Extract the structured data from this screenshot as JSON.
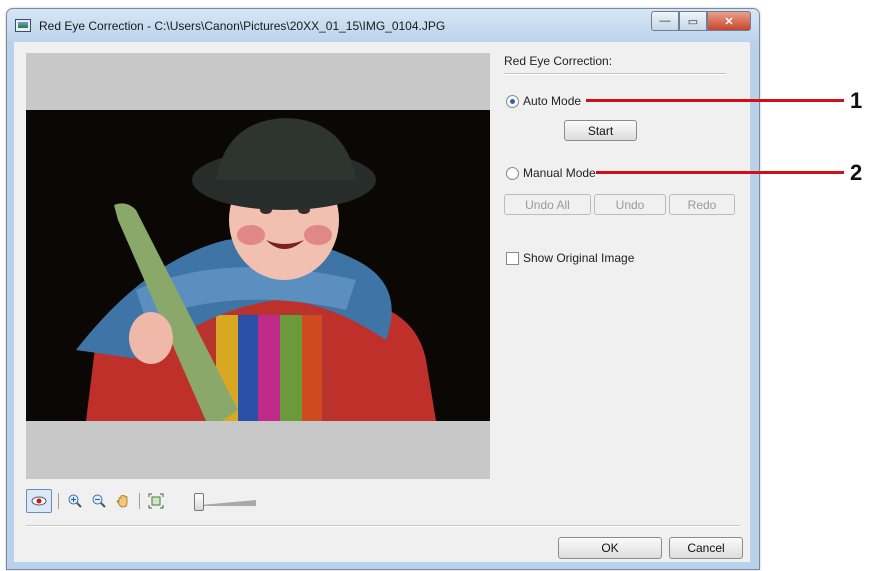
{
  "window": {
    "title": "Red Eye Correction - C:\\Users\\Canon\\Pictures\\20XX_01_15\\IMG_0104.JPG",
    "caption_buttons": {
      "minimize": "—",
      "maximize": "▭",
      "close": "✕"
    }
  },
  "panel": {
    "title": "Red Eye Correction:",
    "auto_mode": {
      "label": "Auto Mode",
      "selected": true
    },
    "start_label": "Start",
    "manual_mode": {
      "label": "Manual Mode",
      "selected": false
    },
    "undo_all_label": "Undo All",
    "undo_label": "Undo",
    "redo_label": "Redo",
    "show_original": {
      "label": "Show Original Image",
      "checked": false
    }
  },
  "toolbar": {
    "icons": [
      "red-eye-icon",
      "zoom-in-icon",
      "zoom-out-icon",
      "hand-icon",
      "fit-to-window-icon"
    ],
    "zoom_slider_level": 0
  },
  "footer": {
    "ok_label": "OK",
    "cancel_label": "Cancel"
  },
  "callouts": [
    {
      "number": "1",
      "target": "auto-mode-radio"
    },
    {
      "number": "2",
      "target": "manual-mode-radio"
    }
  ],
  "colors": {
    "callout_line": "#d20f17",
    "radio_selected": "#2a63b8"
  }
}
